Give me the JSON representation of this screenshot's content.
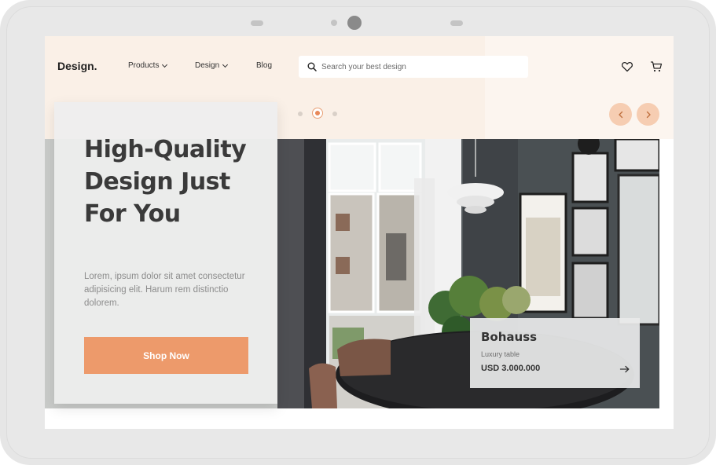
{
  "header": {
    "logo": "Design.",
    "nav": [
      {
        "label": "Products",
        "has_dropdown": true
      },
      {
        "label": "Design",
        "has_dropdown": true
      },
      {
        "label": "Blog",
        "has_dropdown": false
      }
    ],
    "search_placeholder": "Search your best design",
    "icons": [
      "heart-icon",
      "cart-icon"
    ]
  },
  "carousel": {
    "slide_count": 3,
    "active_index": 1,
    "prev_icon": "chevron-left-icon",
    "next_icon": "chevron-right-icon"
  },
  "hero": {
    "title": "High-Quality Design Just For You",
    "description": "Lorem, ipsum dolor sit amet consectetur adipisicing elit. Harum rem distinctio dolorem.",
    "cta_label": "Shop Now"
  },
  "product": {
    "name": "Bohauss",
    "subtitle": "Luxury table",
    "price": "USD 3.000.000",
    "arrow_icon": "arrow-right-icon"
  },
  "colors": {
    "accent": "#ed9a6b",
    "peach_background": "#faf0e7",
    "arrow_button": "#f6cdb2",
    "device_frame": "#e6e6e6"
  }
}
